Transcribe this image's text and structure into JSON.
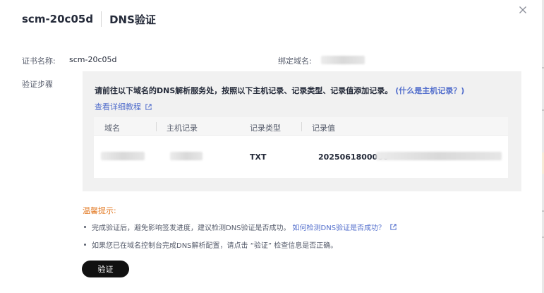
{
  "header": {
    "cert_id": "scm-20c05d",
    "title": "DNS验证"
  },
  "cert_name_label": "证书名称:",
  "cert_name_value": "scm-20c05d",
  "bound_domain_label": "绑定域名:",
  "steps_label": "验证步骤",
  "panel": {
    "instruction": "请前往以下域名的DNS解析服务处，按照以下主机记录、记录类型、记录值添加记录。",
    "what_link": "(什么是主机记录？)",
    "tutorial_link": "查看详细教程"
  },
  "table": {
    "columns": [
      "域名",
      "主机记录",
      "记录类型",
      "记录值"
    ],
    "row": {
      "record_type": "TXT",
      "record_value": "2025061800000"
    }
  },
  "tips": {
    "title": "温馨提示:",
    "tip1": "完成验证后，避免影响签发进度，建议检测DNS验证是否成功。",
    "tip1_link": "如何检测DNS验证是否成功？",
    "tip2": "如果您已在域名控制台完成DNS解析配置，请点击 “验证” 检查信息是否正确。"
  },
  "verify_button": "验证",
  "colors": {
    "link": "#526ecc",
    "warning": "#e37d29",
    "primary_button": "#111111"
  },
  "icons": {
    "close": "close-icon",
    "external_link": "external-link-icon"
  }
}
